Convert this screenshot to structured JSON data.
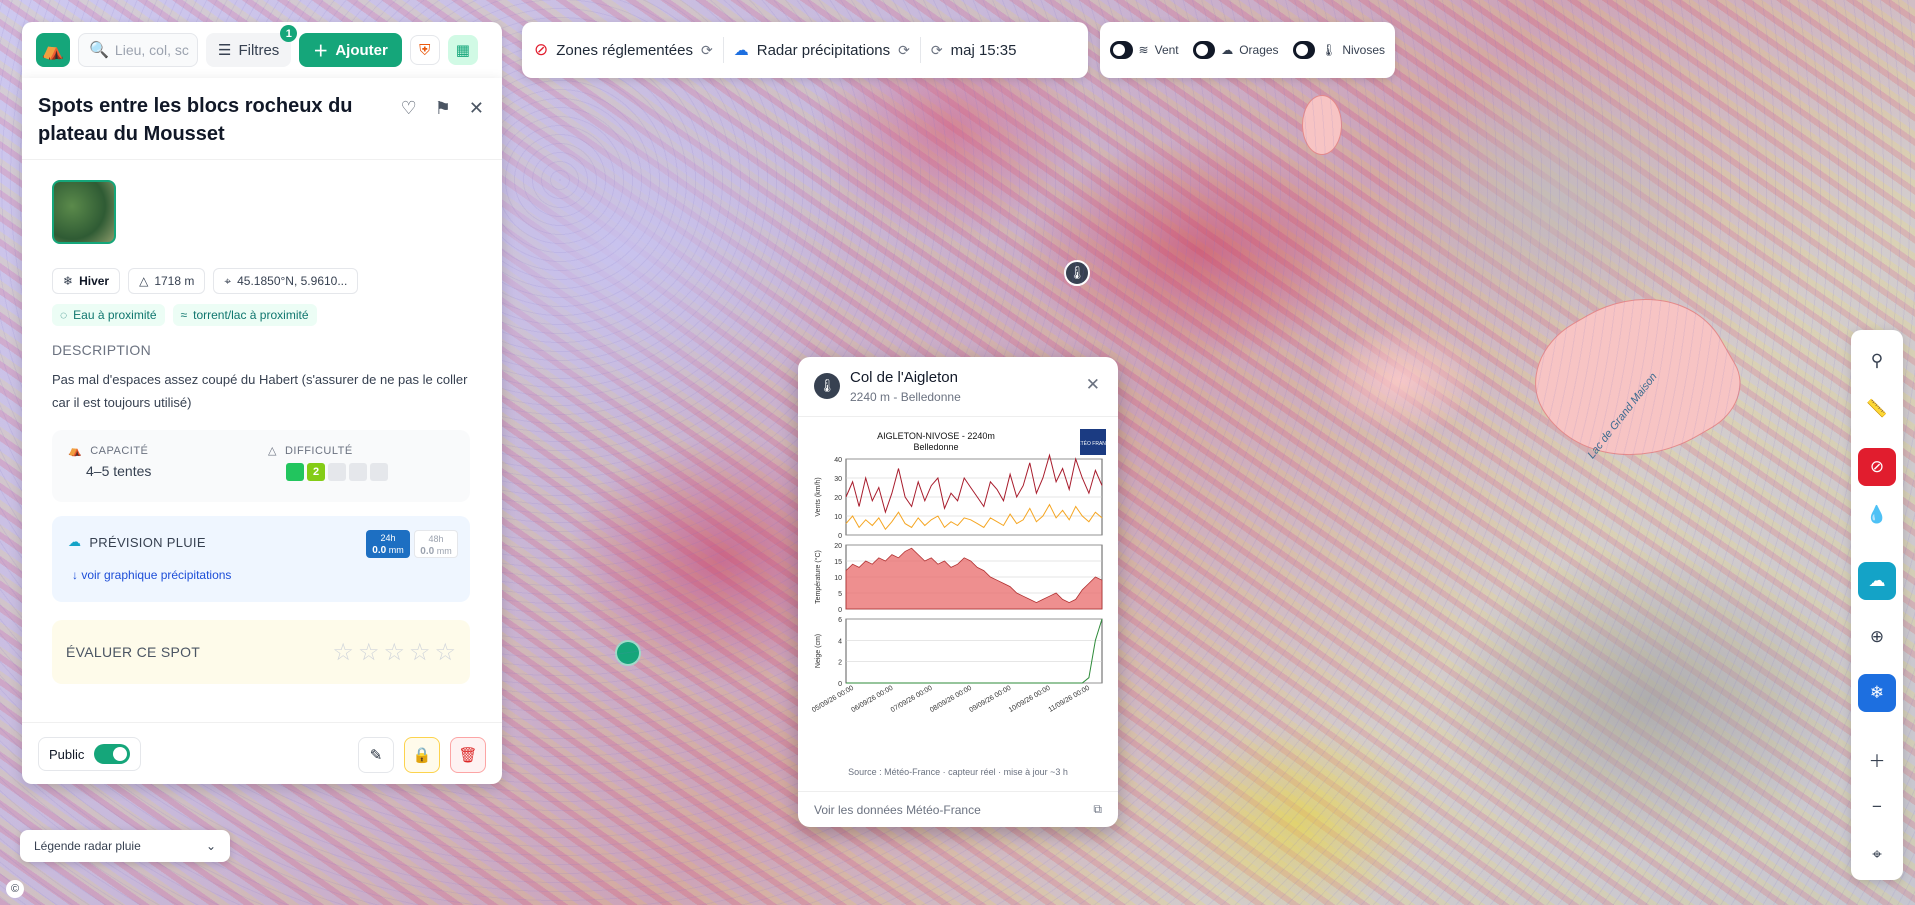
{
  "toolbar": {
    "search_placeholder": "Lieu, col, sc",
    "filters_label": "Filtres",
    "filters_count": "1",
    "add_label": "Ajouter"
  },
  "layers": {
    "zones_label": "Zones réglementées",
    "radar_label": "Radar précipitations",
    "update_label": "maj 15:35",
    "wind_label": "Vent",
    "storms_label": "Orages",
    "nivoses_label": "Nivoses"
  },
  "spot": {
    "title": "Spots entre les blocs rocheux du plateau du Mousset",
    "season": "Hiver",
    "altitude": "1718 m",
    "coords": "45.1850°N, 5.9610...",
    "tags": [
      "Eau à proximité",
      "torrent/lac à proximité"
    ],
    "description_heading": "DESCRIPTION",
    "description": "Pas mal d'espaces assez coupé du Habert (s'assurer de ne pas le coller car il est toujours utilisé)",
    "capacity_label": "CAPACITÉ",
    "capacity_value": "4–5 tentes",
    "difficulty_label": "DIFFICULTÉ",
    "difficulty_level": "2",
    "rain_title": "PRÉVISION PLUIE",
    "rain_24h_label": "24h",
    "rain_24h_value": "0.0",
    "rain_48h_label": "48h",
    "rain_48h_value": "0.0",
    "rain_unit": "mm",
    "rain_link": "↓ voir graphique précipitations",
    "rate_label": "ÉVALUER CE SPOT",
    "public_label": "Public"
  },
  "legend": {
    "label": "Légende radar pluie"
  },
  "map": {
    "lake_label": "Lac de Grand Maison"
  },
  "station": {
    "name": "Col de l'Aigleton",
    "subtitle": "2240 m - Belledonne",
    "source": "Source : Météo-France · capteur réel · mise à jour ~3 h",
    "link": "Voir les données Météo-France"
  },
  "chart_data": {
    "title": "AIGLETON-NIVOSE - 2240m",
    "subtitle": "Belledonne",
    "x": [
      "05/09/26 00:00",
      "06/09/26 00:00",
      "07/09/26 00:00",
      "08/09/26 00:00",
      "09/09/26 00:00",
      "10/09/26 00:00",
      "11/09/26 00:00"
    ],
    "panels": [
      {
        "type": "line",
        "ylabel": "Vents (km/h)",
        "ylim": [
          0,
          40
        ],
        "yticks": [
          0,
          10,
          20,
          30,
          40
        ],
        "series": [
          {
            "color": "#a81c2c",
            "values": [
              20,
              28,
              15,
              30,
              18,
              25,
              12,
              22,
              35,
              20,
              15,
              28,
              18,
              26,
              30,
              14,
              22,
              18,
              30,
              25,
              20,
              15,
              28,
              24,
              18,
              32,
              20,
              26,
              38,
              22,
              30,
              42,
              28,
              35,
              24,
              40,
              30,
              22,
              34,
              26
            ]
          },
          {
            "color": "#f5a623",
            "values": [
              6,
              10,
              4,
              8,
              5,
              9,
              3,
              7,
              12,
              6,
              4,
              9,
              5,
              8,
              10,
              4,
              7,
              5,
              9,
              8,
              6,
              4,
              9,
              7,
              5,
              11,
              6,
              8,
              14,
              7,
              10,
              16,
              9,
              13,
              8,
              15,
              10,
              7,
              12,
              9
            ]
          }
        ]
      },
      {
        "type": "area",
        "ylabel": "Température (°C)",
        "ylim": [
          0,
          20
        ],
        "yticks": [
          0,
          5,
          10,
          15,
          20
        ],
        "series": [
          {
            "color": "#e86a6a",
            "values": [
              12,
              14,
              13,
              15,
              14,
              16,
              15,
              17,
              16,
              18,
              19,
              17,
              15,
              16,
              14,
              15,
              13,
              14,
              16,
              15,
              13,
              12,
              10,
              9,
              8,
              7,
              5,
              4,
              3,
              2,
              3,
              4,
              5,
              3,
              2,
              3,
              6,
              8,
              10,
              9
            ]
          }
        ]
      },
      {
        "type": "line",
        "ylabel": "Neige (cm)",
        "ylim": [
          0,
          6
        ],
        "yticks": [
          0,
          2,
          4,
          6
        ],
        "series": [
          {
            "color": "#2e8b3a",
            "values": [
              0,
              0,
              0,
              0,
              0,
              0,
              0,
              0,
              0,
              0,
              0,
              0,
              0,
              0,
              0,
              0,
              0,
              0,
              0,
              0,
              0,
              0,
              0,
              0,
              0,
              0,
              0,
              0,
              0,
              0,
              0,
              0,
              0,
              0,
              0,
              0,
              0,
              0.5,
              4,
              6
            ]
          }
        ]
      }
    ],
    "logo": "MÉTÉO FRANCE"
  },
  "colors": {
    "accent": "#15a67a",
    "danger": "#e11d2e",
    "rain": "#14a3c7",
    "snow": "#1d6fe0"
  }
}
